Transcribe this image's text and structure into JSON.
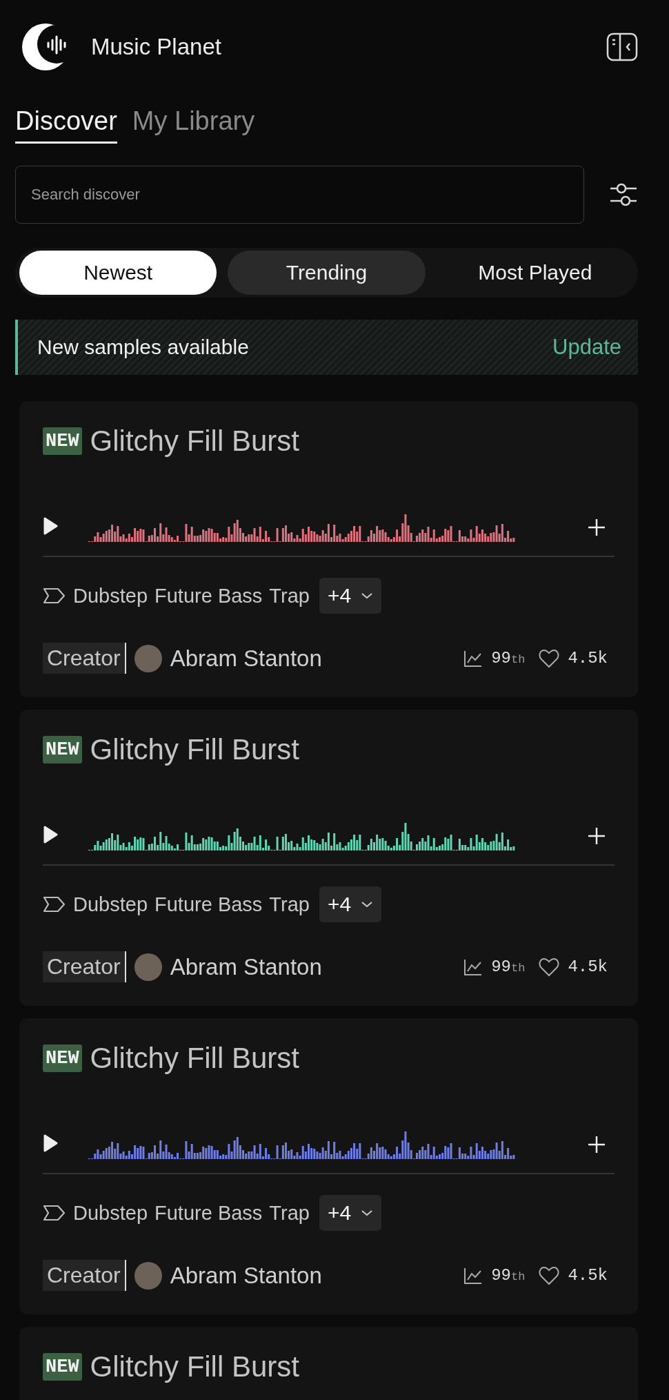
{
  "app": {
    "title": "Music Planet"
  },
  "tabs": [
    {
      "label": "Discover",
      "selected": true
    },
    {
      "label": "My Library",
      "selected": false
    }
  ],
  "search": {
    "placeholder": "Search discover"
  },
  "sort_options": [
    {
      "label": "Newest",
      "selected": true,
      "hovered": false
    },
    {
      "label": "Trending",
      "selected": false,
      "hovered": true
    },
    {
      "label": "Most Played",
      "selected": false,
      "hovered": false
    }
  ],
  "banner": {
    "message": "New samples available",
    "action": "Update"
  },
  "samples": [
    {
      "badge": "NEW",
      "title": "Glitchy Fill Burst",
      "color": "#e0727f",
      "tags": [
        "Dubstep",
        "Future Bass",
        "Trap"
      ],
      "more_tags": "+4",
      "creator_label": "Creator",
      "creator": "Abram Stanton",
      "rank": "99",
      "rank_suffix": "th",
      "likes": "4.5k"
    },
    {
      "badge": "NEW",
      "title": "Glitchy Fill Burst",
      "color": "#5fd6b4",
      "tags": [
        "Dubstep",
        "Future Bass",
        "Trap"
      ],
      "more_tags": "+4",
      "creator_label": "Creator",
      "creator": "Abram Stanton",
      "rank": "99",
      "rank_suffix": "th",
      "likes": "4.5k"
    },
    {
      "badge": "NEW",
      "title": "Glitchy Fill Burst",
      "color": "#6f7ee6",
      "tags": [
        "Dubstep",
        "Future Bass",
        "Trap"
      ],
      "more_tags": "+4",
      "creator_label": "Creator",
      "creator": "Abram Stanton",
      "rank": "99",
      "rank_suffix": "th",
      "likes": "4.5k"
    },
    {
      "badge": "NEW",
      "title": "Glitchy Fill Burst"
    }
  ]
}
